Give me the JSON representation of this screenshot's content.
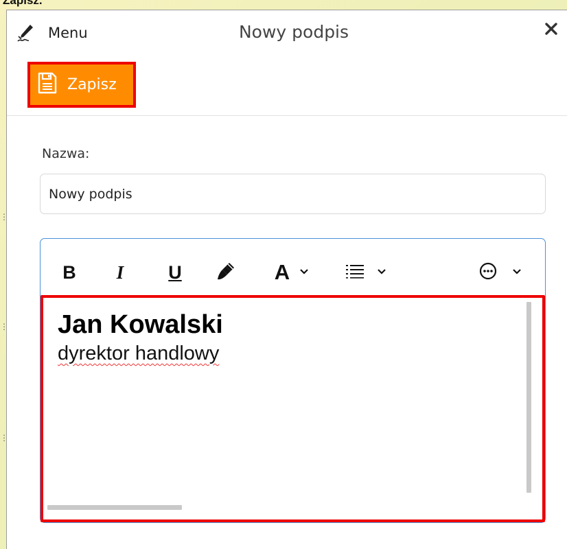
{
  "top_caption": "Zapisz.",
  "header": {
    "menu_label": "Menu",
    "title": "Nowy podpis",
    "close_icon": "close-icon",
    "menu_icon": "signature-pen-icon"
  },
  "toolbar": {
    "save_label": "Zapisz",
    "save_icon": "save-document-icon",
    "save_color": "#ff8c00",
    "highlight_color": "#ee0000"
  },
  "form": {
    "name_label": "Nazwa:",
    "name_value": "Nowy podpis"
  },
  "editor": {
    "buttons": {
      "bold": "B",
      "italic": "I",
      "underline": "U",
      "font_color": "A"
    },
    "content": {
      "name": "Jan Kowalski",
      "role": "dyrektor handlowy"
    }
  }
}
